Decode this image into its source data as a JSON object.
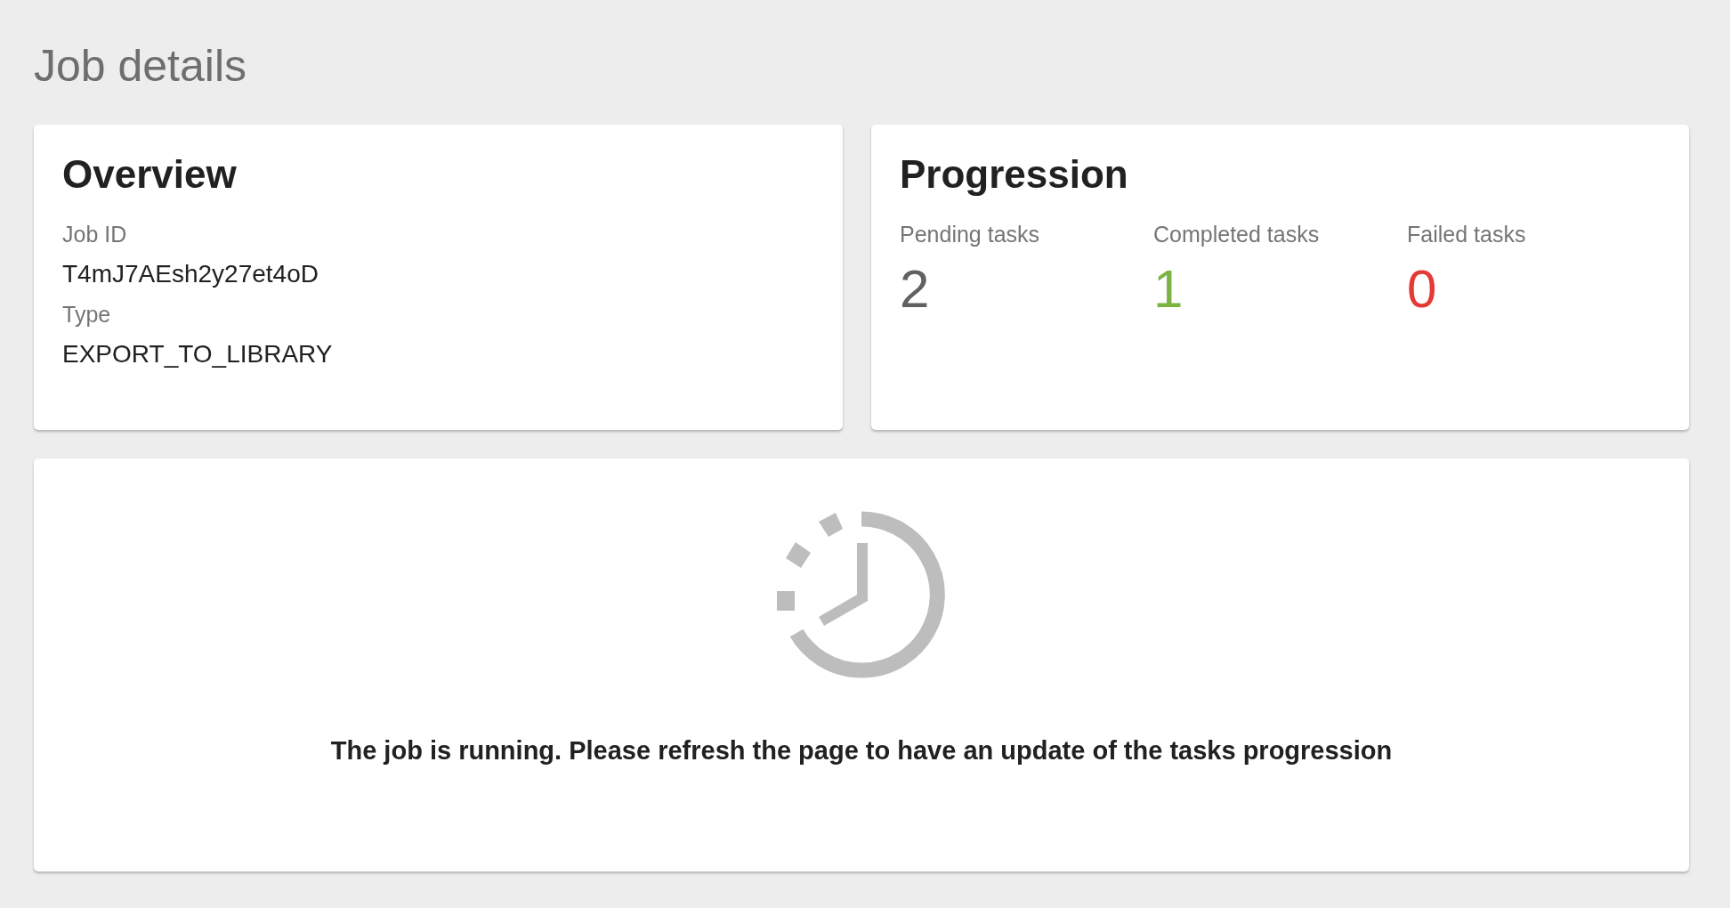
{
  "page_title": "Job details",
  "overview": {
    "title": "Overview",
    "fields": [
      {
        "label": "Job ID",
        "value": "T4mJ7AEsh2y27et4oD"
      },
      {
        "label": "Type",
        "value": "EXPORT_TO_LIBRARY"
      }
    ]
  },
  "progression": {
    "title": "Progression",
    "stats": [
      {
        "label": "Pending tasks",
        "value": "2",
        "color": "#616161"
      },
      {
        "label": "Completed tasks",
        "value": "1",
        "color": "#7cb342"
      },
      {
        "label": "Failed tasks",
        "value": "0",
        "color": "#e53935"
      }
    ]
  },
  "status": {
    "message": "The job is running. Please refresh the page to have an update of the tasks progression"
  }
}
